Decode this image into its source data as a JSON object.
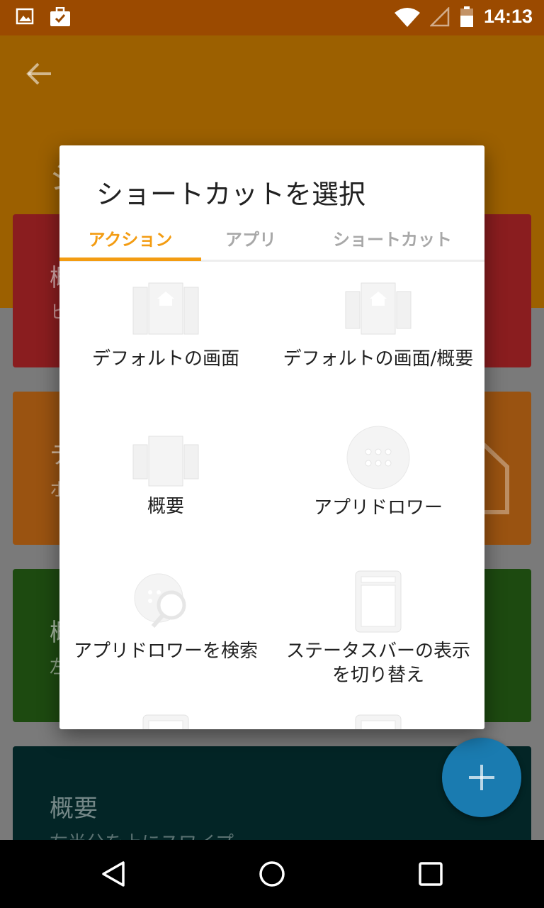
{
  "status_bar": {
    "time": "14:13"
  },
  "background": {
    "cards": [
      {
        "title": "概",
        "subtitle": "ヒ",
        "color": "#8a1d1f"
      },
      {
        "title": "テ",
        "subtitle": "ホ",
        "color": "#9a5311"
      },
      {
        "title": "概",
        "subtitle": "左",
        "color": "#1d4a10"
      },
      {
        "title": "概要",
        "subtitle": "左半分を上にスワイプ",
        "color": "#032526"
      }
    ],
    "title_fragment": "シ"
  },
  "dialog": {
    "title": "ショートカットを選択",
    "tabs": [
      {
        "label": "アクション",
        "active": true
      },
      {
        "label": "アプリ",
        "active": false
      },
      {
        "label": "ショートカット",
        "active": false
      }
    ],
    "items": [
      {
        "label": "デフォルトの画面",
        "icon": "home-screen-icon"
      },
      {
        "label": "デフォルトの画面/概要",
        "icon": "home-overview-icon"
      },
      {
        "label": "概要",
        "icon": "overview-icon"
      },
      {
        "label": "アプリドロワー",
        "icon": "app-drawer-icon"
      },
      {
        "label": "アプリドロワーを検索",
        "icon": "search-drawer-icon"
      },
      {
        "label": "ステータスバーの表示を切り替え",
        "icon": "statusbar-toggle-icon"
      }
    ]
  },
  "colors": {
    "accent": "#f39c12",
    "fab": "#1a7bb0"
  }
}
